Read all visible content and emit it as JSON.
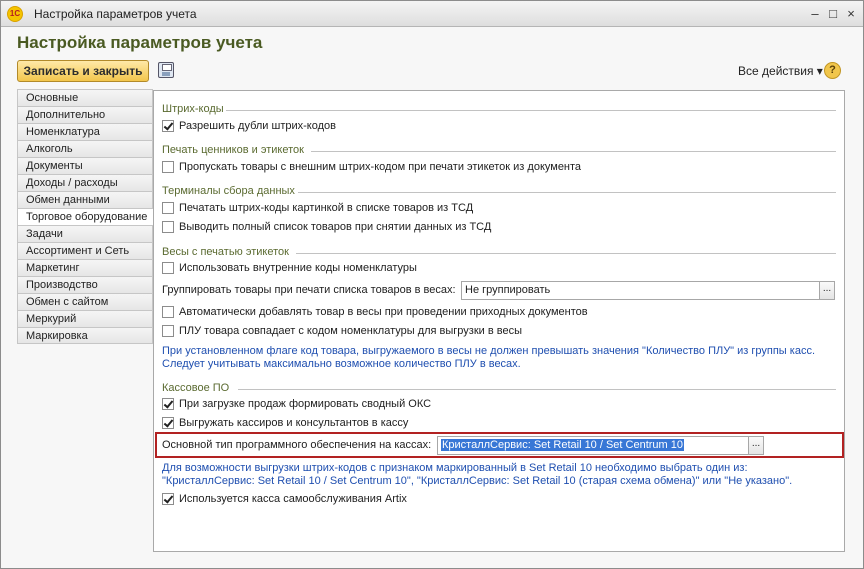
{
  "window": {
    "title": "Настройка параметров учета",
    "logo_text": "1С",
    "minimize": "–",
    "maximize": "□",
    "close": "×"
  },
  "header": {
    "title": "Настройка параметров учета",
    "save_close_label": "Записать и закрыть",
    "all_actions_label": "Все действия ▾",
    "help_label": "?"
  },
  "sidebar": {
    "items": [
      {
        "label": "Основные"
      },
      {
        "label": "Дополнительно"
      },
      {
        "label": "Номенклатура"
      },
      {
        "label": "Алкоголь"
      },
      {
        "label": "Документы"
      },
      {
        "label": "Доходы / расходы"
      },
      {
        "label": "Обмен данными"
      },
      {
        "label": "Торговое оборудование",
        "active": true
      },
      {
        "label": "Задачи"
      },
      {
        "label": "Ассортимент и Сеть"
      },
      {
        "label": "Маркетинг"
      },
      {
        "label": "Производство"
      },
      {
        "label": "Обмен с сайтом"
      },
      {
        "label": "Меркурий"
      },
      {
        "label": "Маркировка"
      }
    ]
  },
  "barcodes": {
    "title": "Штрих-коды",
    "allow_duplicates": {
      "label": "Разрешить дубли штрих-кодов",
      "checked": true
    }
  },
  "price_tags": {
    "title": "Печать ценников и этикеток",
    "skip_external": {
      "label": "Пропускать товары с внешним штрих-кодом при печати этикеток из документа",
      "checked": false
    }
  },
  "terminals": {
    "title": "Терминалы сбора данных",
    "print_barcodes_image": {
      "label": "Печатать штрих-коды картинкой в списке товаров из ТСД",
      "checked": false
    },
    "full_list": {
      "label": "Выводить полный список товаров при снятии данных из ТСД",
      "checked": false
    }
  },
  "scales": {
    "title": "Весы с печатью этикеток",
    "internal_codes": {
      "label": "Использовать внутренние коды номенклатуры",
      "checked": false
    },
    "group_label": "Группировать товары при печати списка товаров в весах:",
    "group_value": "Не группировать",
    "auto_add": {
      "label": "Автоматически добавлять товар в весы при проведении приходных документов",
      "checked": false
    },
    "plu_match": {
      "label": "ПЛУ товара совпадает с кодом номенклатуры для выгрузки в весы",
      "checked": false
    },
    "note_line1": "При установленном флаге код товара, выгружаемого в весы не должен превышать значения \"Количество ПЛУ\" из группы касс.",
    "note_line2": "Следует учитывать максимально возможное количество ПЛУ в весах."
  },
  "pos": {
    "title": "Кассовое ПО",
    "summary_oks": {
      "label": "При загрузке продаж формировать сводный ОКС",
      "checked": true
    },
    "export_cashiers": {
      "label": "Выгружать кассиров и консультантов в кассу",
      "checked": true
    },
    "software_type_label": "Основной тип программного обеспечения на кассах:",
    "software_type_value": "КристаллСервис: Set Retail 10 / Set Centrum 10",
    "note_line1": "Для возможности выгрузки штрих-кодов с признаком маркированный в Set Retail 10 необходимо выбрать один из:",
    "note_line2": "\"КристаллСервис: Set Retail 10 / Set Centrum 10\", \"КристаллСервис: Set Retail 10 (старая схема обмена)\" или \"Не указано\".",
    "artix": {
      "label": "Используется касса самообслуживания Artix",
      "checked": true
    }
  },
  "select_button_label": "..."
}
